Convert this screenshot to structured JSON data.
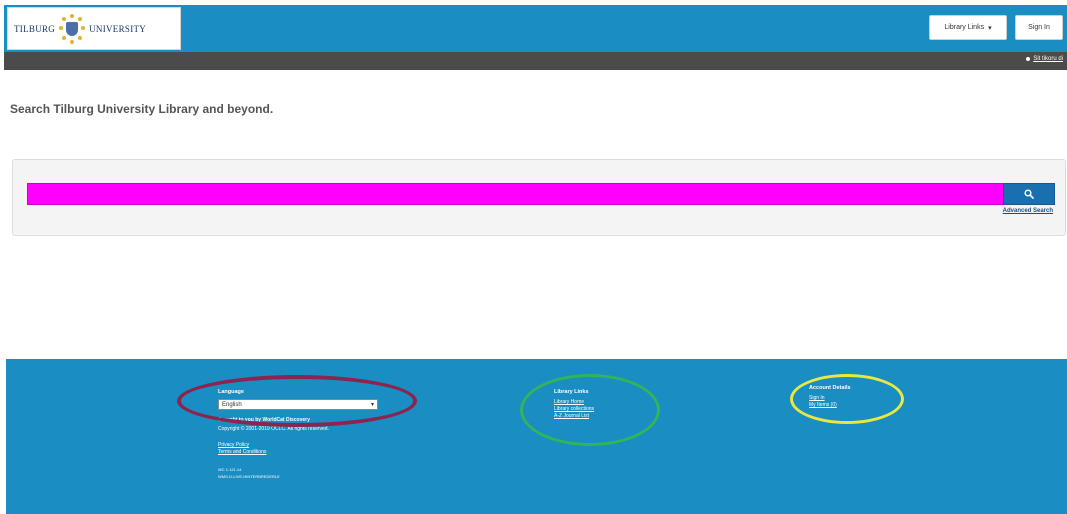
{
  "header": {
    "logo_left": "TILBURG",
    "logo_right": "UNIVERSITY",
    "library_links_button": "Library Links",
    "sign_in_button": "Sign In"
  },
  "subbar": {
    "link": "Sit tikoru di"
  },
  "main": {
    "heading": "Search Tilburg University Library and beyond.",
    "search_value": "",
    "advanced_search": "Advanced Search"
  },
  "footer": {
    "language": {
      "heading": "Language",
      "selected": "English",
      "brought_by": "Brought to you by WorldCat Discovery",
      "copyright": "Copyright © 2001-2019 OCLC. All rights reserved.",
      "privacy": "Privacy Policy",
      "terms": "Terms and Conditions",
      "version": "WC 1.121.14",
      "build": "WMS-D-LIVE-HINTERBREDERLE"
    },
    "library_links": {
      "heading": "Library Links",
      "items": [
        "Library Home",
        "Library collections",
        "A-Z Journal List"
      ]
    },
    "account": {
      "heading": "Account Details",
      "items": [
        "Sign In",
        "My Items (0)"
      ]
    }
  },
  "colors": {
    "brand_blue": "#1a8dc2",
    "search_button_blue": "#1a6fb0",
    "search_highlight": "#ff00ff",
    "annotation_red": "#8b2550",
    "annotation_green": "#31b45a",
    "annotation_yellow": "#e8e842"
  }
}
